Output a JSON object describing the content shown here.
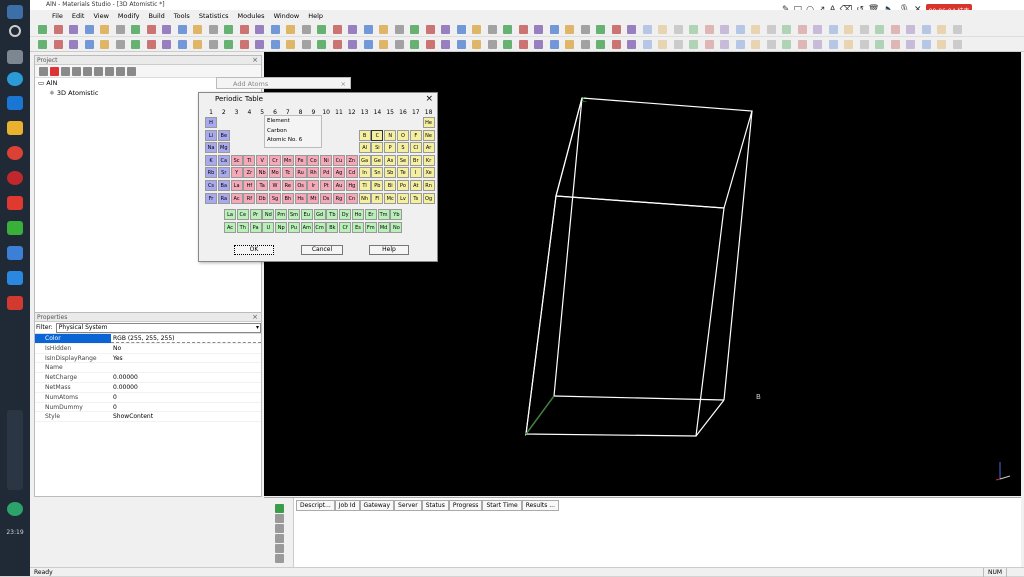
{
  "window": {
    "title": "AlN - Materials Studio - [3D Atomistic *]"
  },
  "menu": [
    "File",
    "Edit",
    "View",
    "Modify",
    "Build",
    "Tools",
    "Statistics",
    "Modules",
    "Window",
    "Help"
  ],
  "clock": "00:06:04 结束",
  "taskbar_time": "23:19",
  "project": {
    "title": "Project",
    "items": [
      "AlN",
      "3D Atomistic"
    ]
  },
  "properties": {
    "title": "Properties",
    "filter_label": "Filter:",
    "filter_value": "Physical System",
    "rows": [
      {
        "name": "Color",
        "value": "RGB (255, 255, 255)"
      },
      {
        "name": "IsHidden",
        "value": "No"
      },
      {
        "name": "IsInDisplayRange",
        "value": "Yes"
      },
      {
        "name": "Name",
        "value": ""
      },
      {
        "name": "NetCharge",
        "value": "0.00000"
      },
      {
        "name": "NetMass",
        "value": "0.00000"
      },
      {
        "name": "NumAtoms",
        "value": "0"
      },
      {
        "name": "NumDummy",
        "value": "0"
      },
      {
        "name": "Style",
        "value": "ShowContent"
      }
    ]
  },
  "add_atoms": {
    "title": "Add Atoms"
  },
  "periodic_table": {
    "title": "Periodic Table",
    "groups": [
      "1",
      "2",
      "3",
      "4",
      "5",
      "6",
      "7",
      "8",
      "9",
      "10",
      "11",
      "12",
      "13",
      "14",
      "15",
      "16",
      "17",
      "18"
    ],
    "info": {
      "element_label": "Element",
      "name": "Carbon",
      "atomic_no": "Atomic No. 6"
    },
    "rows": [
      [
        "H",
        "",
        "",
        "",
        "",
        "",
        "",
        "",
        "",
        "",
        "",
        "",
        "",
        "",
        "",
        "",
        "",
        "He"
      ],
      [
        "Li",
        "Be",
        "",
        "",
        "",
        "",
        "",
        "",
        "",
        "",
        "",
        "",
        "B",
        "C",
        "N",
        "O",
        "F",
        "Ne"
      ],
      [
        "Na",
        "Mg",
        "",
        "",
        "",
        "",
        "",
        "",
        "",
        "",
        "",
        "",
        "Al",
        "Si",
        "P",
        "S",
        "Cl",
        "Ar"
      ],
      [
        "K",
        "Ca",
        "Sc",
        "Ti",
        "V",
        "Cr",
        "Mn",
        "Fe",
        "Co",
        "Ni",
        "Cu",
        "Zn",
        "Ga",
        "Ge",
        "As",
        "Se",
        "Br",
        "Kr"
      ],
      [
        "Rb",
        "Sr",
        "Y",
        "Zr",
        "Nb",
        "Mo",
        "Tc",
        "Ru",
        "Rh",
        "Pd",
        "Ag",
        "Cd",
        "In",
        "Sn",
        "Sb",
        "Te",
        "I",
        "Xe"
      ],
      [
        "Cs",
        "Ba",
        "La",
        "Hf",
        "Ta",
        "W",
        "Re",
        "Os",
        "Ir",
        "Pt",
        "Au",
        "Hg",
        "Tl",
        "Pb",
        "Bi",
        "Po",
        "At",
        "Rn"
      ],
      [
        "Fr",
        "Ra",
        "Ac",
        "Rf",
        "Db",
        "Sg",
        "Bh",
        "Hs",
        "Mt",
        "Ds",
        "Rg",
        "Cn",
        "Nh",
        "Fl",
        "Mc",
        "Lv",
        "Ts",
        "Og"
      ]
    ],
    "lanthanides": [
      "La",
      "Ce",
      "Pr",
      "Nd",
      "Pm",
      "Sm",
      "Eu",
      "Gd",
      "Tb",
      "Dy",
      "Ho",
      "Er",
      "Tm",
      "Yb"
    ],
    "actinides": [
      "Ac",
      "Th",
      "Pa",
      "U",
      "Np",
      "Pu",
      "Am",
      "Cm",
      "Bk",
      "Cf",
      "Es",
      "Fm",
      "Md",
      "No"
    ],
    "buttons": {
      "ok": "OK",
      "cancel": "Cancel",
      "help": "Help"
    },
    "colors": {
      "s_block": "#a9a9f0",
      "d_block": "#f5a9b8",
      "p_block": "#f5f0a0",
      "f_block": "#b8f0b8"
    }
  },
  "viewer": {
    "axis_labels": {
      "c": "C",
      "b": "B"
    }
  },
  "jobs": {
    "columns": [
      "Descript...",
      "Job Id",
      "Gateway",
      "Server",
      "Status",
      "Progress",
      "Start Time",
      "Results ..."
    ]
  },
  "status": {
    "text": "Ready",
    "num": "NUM"
  }
}
